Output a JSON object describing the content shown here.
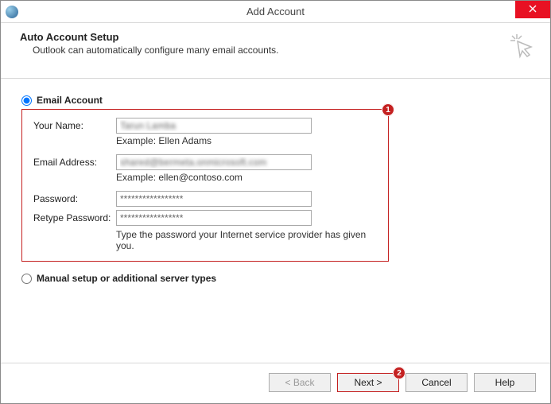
{
  "window": {
    "title": "Add Account"
  },
  "header": {
    "title": "Auto Account Setup",
    "subtitle": "Outlook can automatically configure many email accounts."
  },
  "form": {
    "email_account_label": "Email Account",
    "manual_setup_label": "Manual setup or additional server types",
    "name_label": "Your Name:",
    "name_value": "Tarun Lamba",
    "name_example": "Example: Ellen Adams",
    "email_label": "Email Address:",
    "email_value": "shared@bermeta.onmicrosoft.com",
    "email_example": "Example: ellen@contoso.com",
    "password_label": "Password:",
    "password_value": "*****************",
    "retype_label": "Retype Password:",
    "retype_value": "*****************",
    "password_hint": "Type the password your Internet service provider has given you."
  },
  "buttons": {
    "back": "< Back",
    "next": "Next >",
    "cancel": "Cancel",
    "help": "Help"
  },
  "badges": {
    "one": "1",
    "two": "2"
  }
}
